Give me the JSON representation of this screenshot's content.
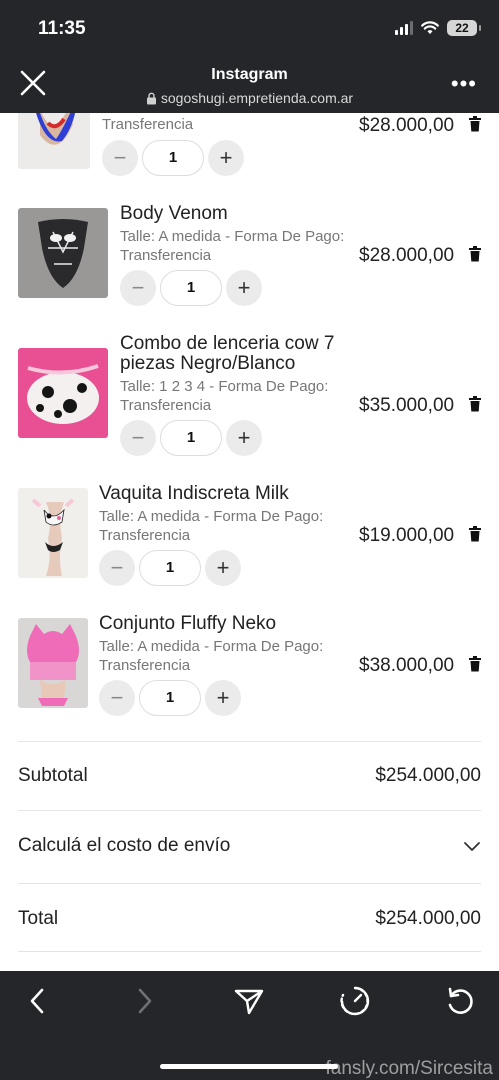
{
  "status_bar": {
    "time": "11:35",
    "battery": "22"
  },
  "browser": {
    "title": "Instagram",
    "url": "sogoshugi.empretienda.com.ar"
  },
  "cart": {
    "items": [
      {
        "name": "",
        "meta_line1": "",
        "meta_line2": "Transferencia",
        "price": "$28.000,00",
        "quantity": "1"
      },
      {
        "name": "Body Venom",
        "meta_line1": "Talle: A medida - Forma De Pago:",
        "meta_line2": "Transferencia",
        "price": "$28.000,00",
        "quantity": "1"
      },
      {
        "name_line1": "Combo de lenceria cow 7",
        "name_line2": "piezas Negro/Blanco",
        "meta_line1": "Talle: 1 2 3 4 - Forma De Pago:",
        "meta_line2": "Transferencia",
        "price": "$35.000,00",
        "quantity": "1"
      },
      {
        "name": "Vaquita Indiscreta Milk",
        "meta_line1": "Talle: A medida - Forma De Pago:",
        "meta_line2": "Transferencia",
        "price": "$19.000,00",
        "quantity": "1"
      },
      {
        "name": "Conjunto Fluffy Neko",
        "meta_line1": "Talle: A medida - Forma De Pago:",
        "meta_line2": "Transferencia",
        "price": "$38.000,00",
        "quantity": "1"
      }
    ],
    "subtotal_label": "Subtotal",
    "subtotal_value": "$254.000,00",
    "shipping_label": "Calculá el costo de envío",
    "total_label": "Total",
    "total_value": "$254.000,00"
  },
  "watermark": "fansly.com/Sircesita",
  "icons": {
    "close": "close-icon",
    "lock": "lock-icon",
    "more": "more-icon",
    "trash": "trash-icon",
    "minus": "minus-icon",
    "plus": "plus-icon",
    "chevron": "chevron-down-icon",
    "back": "back-icon",
    "forward": "forward-icon",
    "share": "share-icon",
    "speed": "speed-icon",
    "reload": "reload-icon"
  },
  "colors": {
    "chrome": "#242629",
    "text": "#222222",
    "muted": "#777777",
    "button_bg": "#ebebeb"
  }
}
